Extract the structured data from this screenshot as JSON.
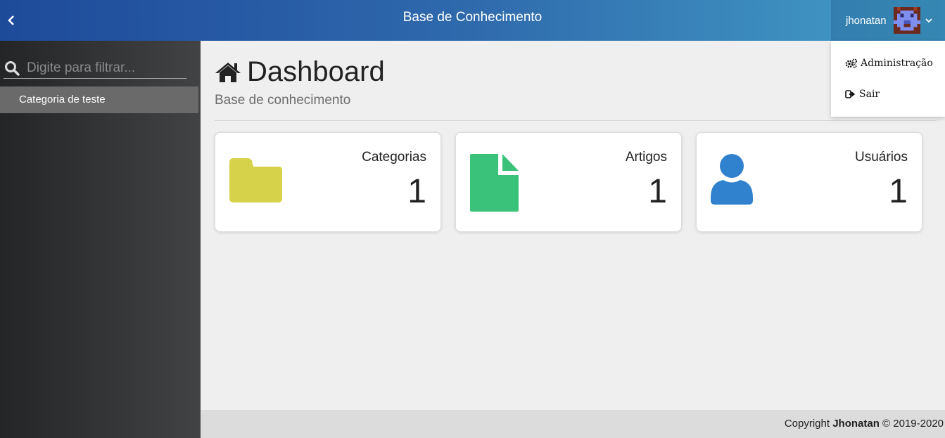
{
  "header": {
    "title": "Base de Conhecimento",
    "user_name": "jhonatan",
    "colors": {
      "gradient_start": "#1e4a9a",
      "gradient_end": "#44a0c8"
    }
  },
  "dropdown": {
    "items": [
      {
        "label": "Administração",
        "icon": "cogs-icon"
      },
      {
        "label": "Sair",
        "icon": "sign-out-icon"
      }
    ]
  },
  "sidebar": {
    "search_placeholder": "Digite para filtrar...",
    "categories": [
      "Categoria de teste"
    ]
  },
  "main": {
    "title": "Dashboard",
    "subtitle": "Base de conhecimento",
    "stats": [
      {
        "label": "Categorias",
        "value": "1",
        "icon": "folder-icon",
        "color": "#d6d34b"
      },
      {
        "label": "Artigos",
        "value": "1",
        "icon": "file-icon",
        "color": "#3bc27a"
      },
      {
        "label": "Usuários",
        "value": "1",
        "icon": "user-icon",
        "color": "#3182ce"
      }
    ]
  },
  "footer": {
    "prefix": "Copyright",
    "author": "Jhonatan",
    "suffix": "© 2019-2020"
  }
}
